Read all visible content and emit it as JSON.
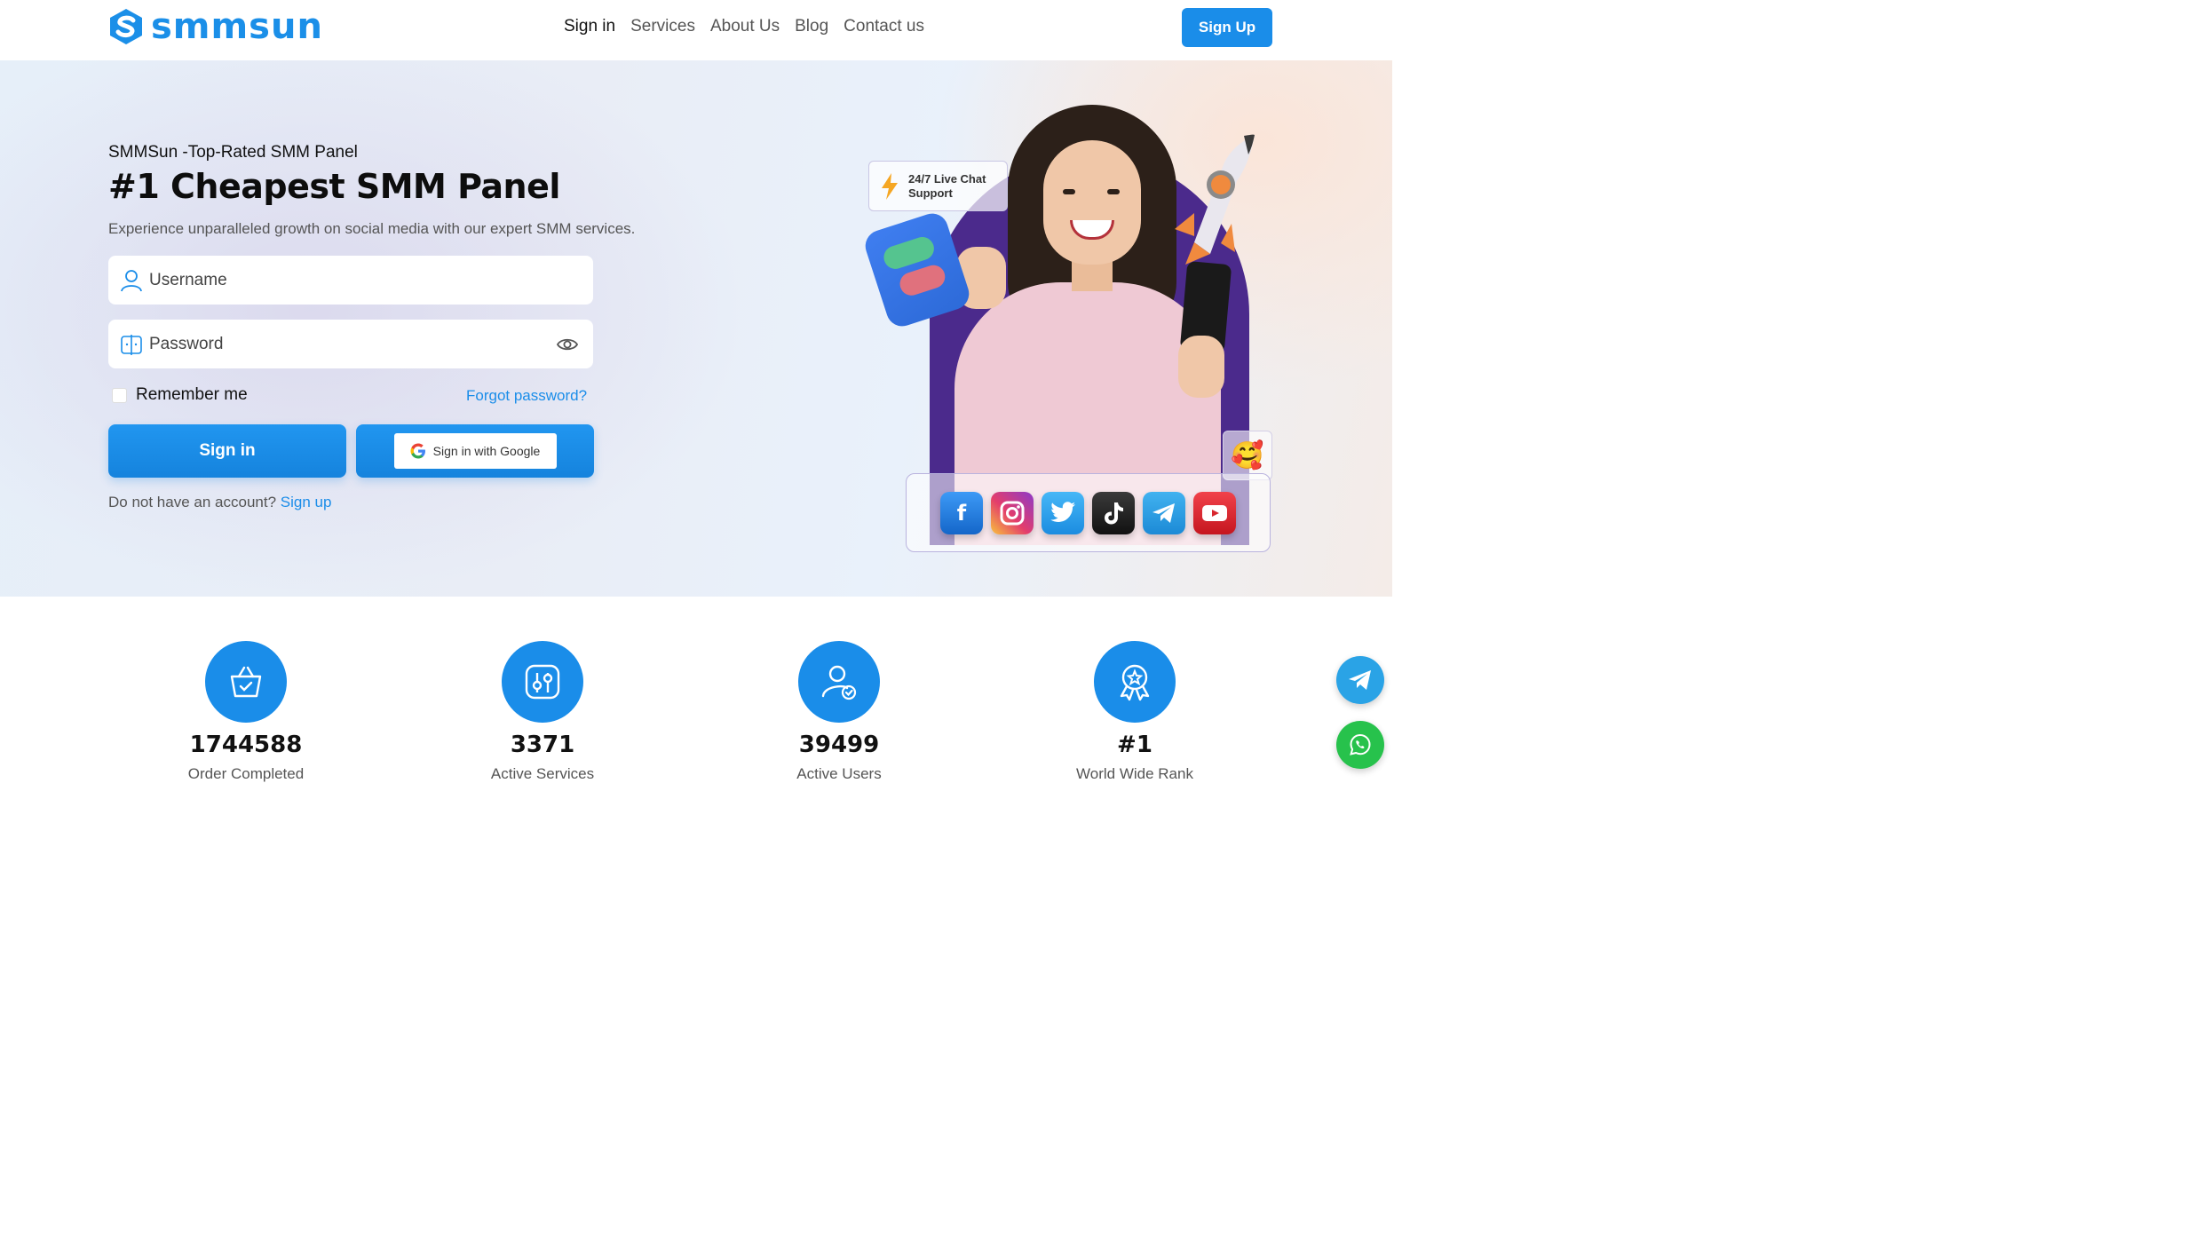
{
  "header": {
    "logo_text": "smmsun",
    "nav": [
      "Sign in",
      "Services",
      "About Us",
      "Blog",
      "Contact us"
    ],
    "signup_label": "Sign Up"
  },
  "hero": {
    "eyebrow": "SMMSun -Top-Rated SMM Panel",
    "title": "#1 Cheapest SMM Panel",
    "subtitle": "Experience unparalleled growth on social media with our expert SMM services.",
    "username_placeholder": "Username",
    "password_placeholder": "Password",
    "remember_label": "Remember me",
    "forgot_label": "Forgot password?",
    "signin_label": "Sign in",
    "google_label": "Sign in with Google",
    "no_account_text": "Do not have an account?",
    "signup_link": "Sign up"
  },
  "illustration": {
    "chat_support_line1": "24/7 Live Chat",
    "chat_support_line2": "Support",
    "emoji": "🥰",
    "socials": [
      "facebook",
      "instagram",
      "twitter",
      "tiktok",
      "telegram",
      "youtube"
    ]
  },
  "stats": [
    {
      "icon": "basket-check-icon",
      "value": "1744588",
      "label": "Order Completed"
    },
    {
      "icon": "sliders-icon",
      "value": "3371",
      "label": "Active Services"
    },
    {
      "icon": "user-check-icon",
      "value": "39499",
      "label": "Active Users"
    },
    {
      "icon": "award-icon",
      "value": "#1",
      "label": "World Wide Rank"
    }
  ],
  "colors": {
    "accent": "#1a8de9",
    "telegram": "#2aa3e6",
    "whatsapp": "#27c24c"
  }
}
